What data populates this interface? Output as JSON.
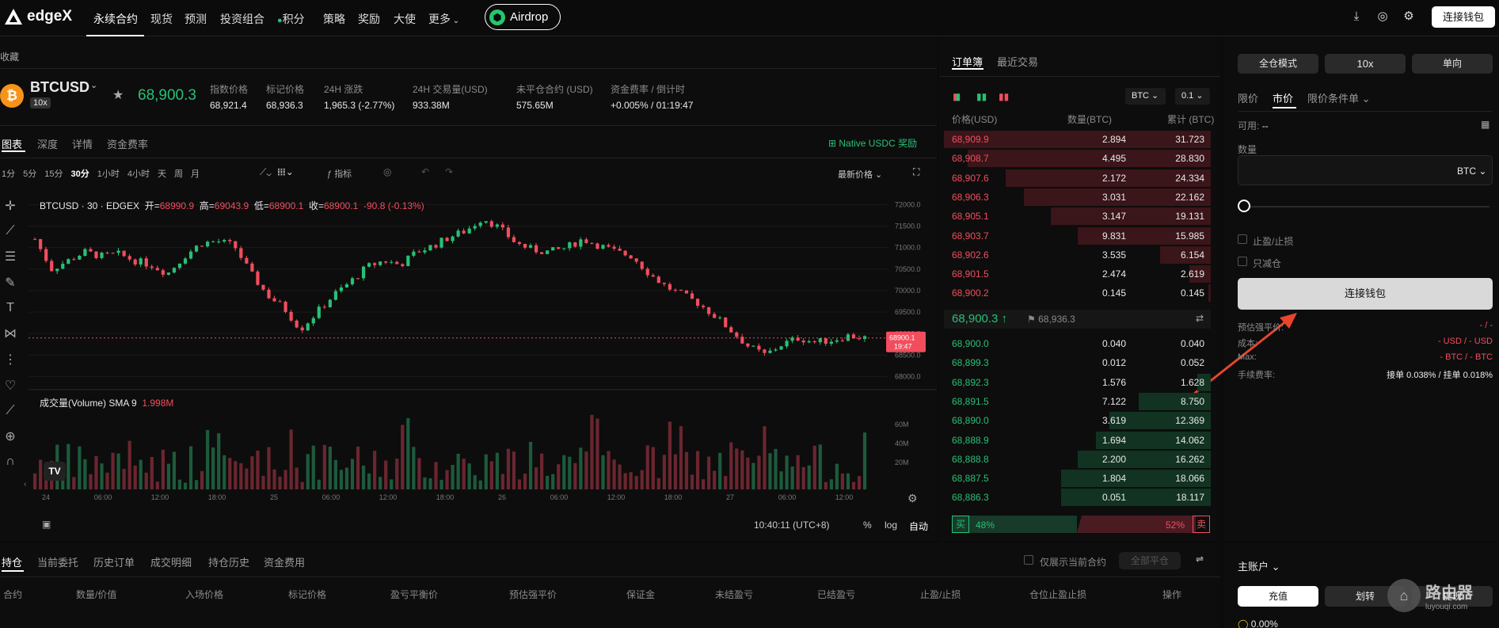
{
  "nav": {
    "brand": "edgeX",
    "items": [
      "永续合约",
      "现货",
      "预测",
      "投资组合",
      "积分",
      "策略",
      "奖励",
      "大使",
      "更多"
    ],
    "airdrop": "Airdrop",
    "connect": "连接钱包"
  },
  "favorites": "收藏",
  "instrument": {
    "symbol": "BTCUSD",
    "leverage": "10x",
    "price": "68,900.3",
    "stats": [
      {
        "k": "指数价格",
        "v": "68,921.4",
        "c": ""
      },
      {
        "k": "标记价格",
        "v": "68,936.3",
        "c": ""
      },
      {
        "k": "24H 涨跌",
        "v": "1,965.3 (-2.77%)",
        "c": "red"
      },
      {
        "k": "24H 交易量(USD)",
        "v": "933.38M",
        "c": ""
      },
      {
        "k": "未平仓合约 (USD)",
        "v": "575.65M",
        "c": ""
      },
      {
        "k": "资金费率 / 倒计时",
        "v": "+0.005%",
        "v2": " / 01:19:47",
        "c": "green"
      }
    ]
  },
  "chart_tabs": [
    "图表",
    "深度",
    "详情",
    "资金费率"
  ],
  "native_reward": "Native USDC 奖励",
  "timeframes": [
    "1分",
    "5分",
    "15分",
    "30分",
    "1小时",
    "4小时",
    "天",
    "周",
    "月"
  ],
  "indicators": "指标",
  "latest_price": "最新价格",
  "chart_data": {
    "type": "candlestick",
    "title": "BTCUSD · 30 · EDGEX",
    "ohlc": {
      "o_label": "开=",
      "o": "68990.9",
      "h_label": "高=",
      "h": "69043.9",
      "l_label": "低=",
      "l": "68900.1",
      "c_label": "收=",
      "c": "68900.1",
      "chg": "-90.8 (-0.13%)"
    },
    "y_ticks": [
      "72000.0",
      "71500.0",
      "71000.0",
      "70500.0",
      "70000.0",
      "69500.0",
      "69000.0",
      "68500.0",
      "68000.0"
    ],
    "ylim": [
      67900,
      72100
    ],
    "x_ticks": [
      "24",
      "06:00",
      "12:00",
      "18:00",
      "25",
      "06:00",
      "12:00",
      "18:00",
      "26",
      "06:00",
      "12:00",
      "18:00",
      "27",
      "06:00",
      "12:00"
    ],
    "last_price_tag": "68900.1",
    "last_time_tag": "19:47",
    "close_path": [
      71200,
      70500,
      70700,
      70900,
      70800,
      70850,
      70700,
      70600,
      70400,
      70800,
      71100,
      71150,
      71050,
      70400,
      69900,
      69600,
      69100,
      69500,
      69900,
      70200,
      70550,
      70700,
      70600,
      70900,
      71050,
      71250,
      71400,
      71700,
      71450,
      71100,
      70950,
      70900,
      71000,
      71200,
      71050,
      70900,
      70800,
      70400,
      70100,
      69900,
      69700,
      69400,
      69050,
      68700,
      68500,
      68750,
      68900,
      68800,
      68850,
      68950,
      68900
    ],
    "volume": {
      "label": "成交量(Volume) SMA 9",
      "value": "1.998M",
      "y_ticks": [
        "60M",
        "40M",
        "20M"
      ]
    }
  },
  "chart_footer": {
    "time": "10:40:11 (UTC+8)",
    "pct": "%",
    "log": "log",
    "auto": "自动"
  },
  "orderbook": {
    "tabs": [
      "订单簿",
      "最近交易"
    ],
    "asset": "BTC",
    "step": "0.1",
    "headers": [
      "价格(USD)",
      "数量(BTC)",
      "累计 (BTC)"
    ],
    "asks": [
      [
        "68,909.9",
        "2.894",
        "31.723",
        1.0
      ],
      [
        "68,908.7",
        "4.495",
        "28.830",
        0.91
      ],
      [
        "68,907.6",
        "2.172",
        "24.334",
        0.77
      ],
      [
        "68,906.3",
        "3.031",
        "22.162",
        0.7
      ],
      [
        "68,905.1",
        "3.147",
        "19.131",
        0.6
      ],
      [
        "68,903.7",
        "9.831",
        "15.985",
        0.5
      ],
      [
        "68,902.6",
        "3.535",
        "6.154",
        0.19
      ],
      [
        "68,901.5",
        "2.474",
        "2.619",
        0.08
      ],
      [
        "68,900.2",
        "0.145",
        "0.145",
        0.01
      ]
    ],
    "mid": "68,900.3",
    "mark": "68,936.3",
    "bids": [
      [
        "68,900.0",
        "0.040",
        "0.040",
        0.0
      ],
      [
        "68,899.3",
        "0.012",
        "0.052",
        0.0
      ],
      [
        "68,892.3",
        "1.576",
        "1.628",
        0.05
      ],
      [
        "68,891.5",
        "7.122",
        "8.750",
        0.27
      ],
      [
        "68,890.0",
        "3.619",
        "12.369",
        0.38
      ],
      [
        "68,888.9",
        "1.694",
        "14.062",
        0.43
      ],
      [
        "68,888.8",
        "2.200",
        "16.262",
        0.5
      ],
      [
        "68,887.5",
        "1.804",
        "18.066",
        0.56
      ],
      [
        "68,886.3",
        "0.051",
        "18.117",
        0.56
      ]
    ],
    "buy_label": "买",
    "buy_pct": "48%",
    "sell_pct": "52%",
    "sell_label": "卖"
  },
  "order_form": {
    "margin_mode": "全仓模式",
    "leverage": "10x",
    "position_mode": "单向",
    "types": [
      "限价",
      "市价",
      "限价条件单"
    ],
    "available_label": "可用:",
    "available": "--",
    "qty_label": "数量",
    "qty_unit": "BTC",
    "tp_sl": "止盈/止损",
    "reduce_only": "只减仓",
    "connect": "连接钱包",
    "info": [
      [
        "预估强平价:",
        "- / -"
      ],
      [
        "成本:",
        "- USD / - USD"
      ],
      [
        "Max:",
        "- BTC / - BTC"
      ],
      [
        "手续费率:",
        "接单 0.038% / 挂单 0.018%"
      ]
    ]
  },
  "positions": {
    "tabs": [
      "持仓",
      "当前委托",
      "历史订单",
      "成交明细",
      "持仓历史",
      "资金费用"
    ],
    "only_current": "仅展示当前合约",
    "close_all": "全部平仓",
    "columns": [
      "合约",
      "数量/价值",
      "入场价格",
      "标记价格",
      "盈亏平衡价",
      "预估强平价",
      "保证金",
      "未结盈亏",
      "已结盈亏",
      "止盈/止损",
      "仓位止盈止损",
      "操作"
    ]
  },
  "account": {
    "title": "主账户",
    "deposit": "充值",
    "transfer": "划转",
    "withdraw": "提现",
    "pct": "0.00%"
  },
  "watermark": {
    "text": "路由器",
    "sub": "luyouqi.com"
  }
}
